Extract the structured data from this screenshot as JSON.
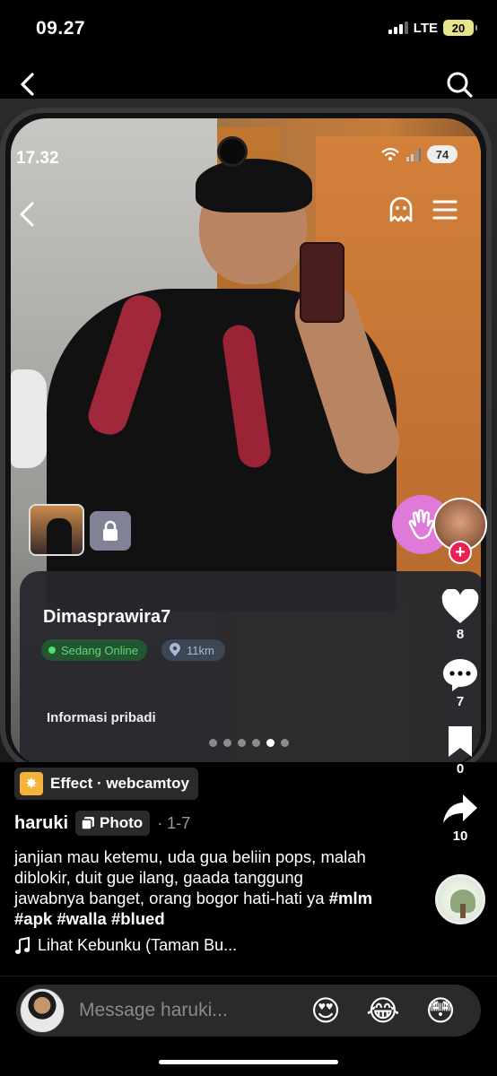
{
  "status_bar": {
    "time": "09.27",
    "network": "LTE",
    "battery": "20"
  },
  "photo_screen": {
    "time": "17.32",
    "battery": "74",
    "profile_name": "Dimasprawira7",
    "online_status": "Sedang Online",
    "distance": "11km",
    "section_label": "Informasi pribadi"
  },
  "pager": {
    "total": 6,
    "active_index": 4
  },
  "rail": {
    "likes": "8",
    "comments": "7",
    "saves": "0",
    "shares": "10"
  },
  "post": {
    "effect_label": "Effect · webcamtoy",
    "author": "haruki",
    "type_label": "Photo",
    "date": "· 1-7",
    "caption_text": "janjian mau ketemu, uda gua beliin pops, malah diblokir, duit gue ilang, gaada tanggung jawabnya banget, orang bogor hati-hati ya ",
    "hashtags": [
      "#mlm",
      "#apk",
      "#walla",
      "#blued"
    ],
    "music": "Lihat Kebunku (Taman Bu..."
  },
  "message_bar": {
    "placeholder": "Message haruki...",
    "emojis": [
      "😍",
      "😂",
      "😳"
    ]
  },
  "colors": {
    "accent_red": "#ee1d52",
    "wave_pink": "#e07ad8",
    "online_green": "#52e06a"
  }
}
